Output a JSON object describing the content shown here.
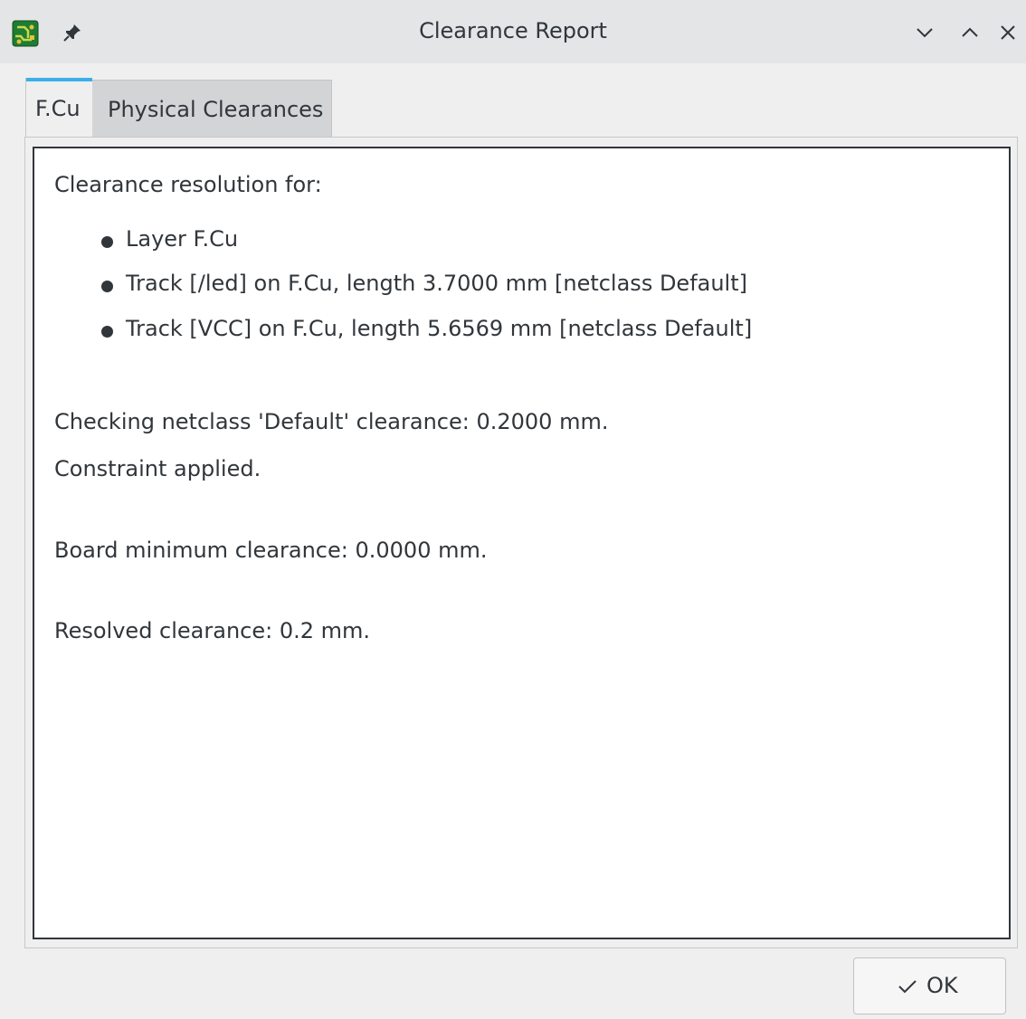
{
  "window": {
    "title": "Clearance Report",
    "app_icon": "pcbnew-icon",
    "controls": [
      "chevron-down-icon",
      "chevron-up-icon",
      "close-icon"
    ]
  },
  "tabs": [
    {
      "label": "F.Cu",
      "active": true
    },
    {
      "label": "Physical Clearances",
      "active": false
    }
  ],
  "report": {
    "heading": "Clearance resolution for:",
    "items": [
      "Layer F.Cu",
      "Track [/led] on F.Cu, length 3.7000 mm [netclass Default]",
      "Track [VCC] on F.Cu, length 5.6569 mm [netclass Default]"
    ],
    "checking": "Checking netclass 'Default' clearance: 0.2000 mm.",
    "applied": "Constraint applied.",
    "board_min": "Board minimum clearance: 0.0000 mm.",
    "resolved": "Resolved clearance: 0.2 mm."
  },
  "buttons": {
    "ok_label": "OK"
  },
  "colors": {
    "accent": "#3daee9",
    "text": "#31363b"
  }
}
